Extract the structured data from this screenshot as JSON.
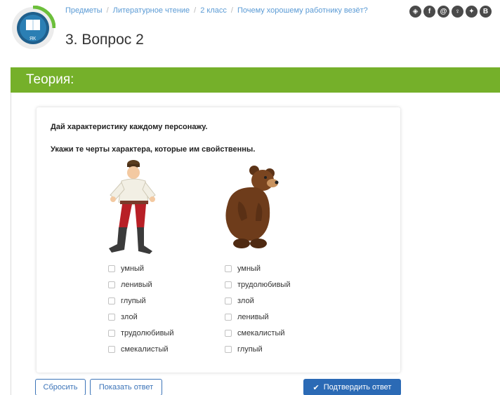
{
  "breadcrumb": {
    "items": [
      "Предметы",
      "Литературное чтение",
      "2 класс",
      "Почему хорошему работнику везёт?"
    ],
    "separator": "/"
  },
  "page": {
    "title": "3. Вопрос 2"
  },
  "socials": [
    "vk",
    "facebook",
    "mail",
    "odnoklassniki",
    "twitter",
    "vkontakte-b"
  ],
  "socials_text": {
    "last": "В"
  },
  "theory": {
    "heading": "Теория:"
  },
  "task": {
    "line1": "Дай характеристику каждому персонажу.",
    "line2": "Укажи те черты характера, которые им свойственны.",
    "left_options": [
      "умный",
      "ленивый",
      "глупый",
      "злой",
      "трудолюбивый",
      "смекалистый"
    ],
    "right_options": [
      "умный",
      "трудолюбивый",
      "злой",
      "ленивый",
      "смекалистый",
      "глупый"
    ]
  },
  "buttons": {
    "reset": "Сбросить",
    "show_answer": "Показать ответ",
    "submit": "Подтвердить ответ"
  },
  "colors": {
    "accent_green": "#75b02a",
    "link_blue": "#5b9bd5",
    "button_blue": "#2b6ab5"
  }
}
